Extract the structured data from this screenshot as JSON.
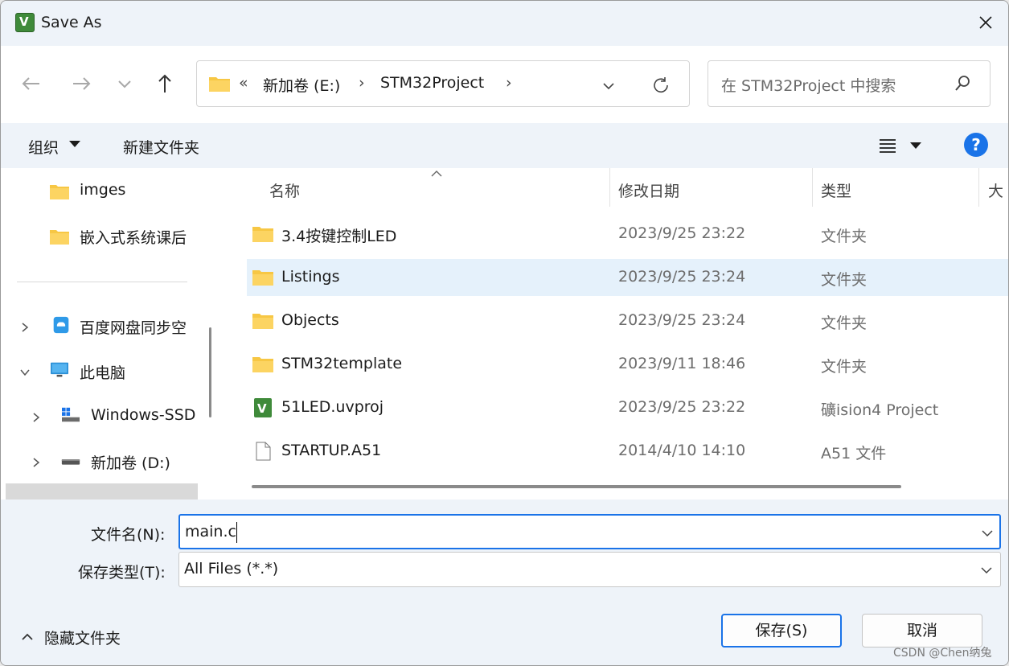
{
  "window": {
    "title": "Save As"
  },
  "nav": {
    "address": {
      "prefix": "«",
      "segments": [
        "新加卷 (E:)",
        "STM32Project"
      ]
    },
    "search_placeholder": "在 STM32Project 中搜索"
  },
  "toolbar": {
    "organize": "组织",
    "new_folder": "新建文件夹",
    "help": "?"
  },
  "sidebar": {
    "items": [
      {
        "label": "imges",
        "icon": "folder-icon"
      },
      {
        "label": "嵌入式系统课后",
        "icon": "folder-icon"
      },
      {
        "label": "百度网盘同步空",
        "icon": "cloud-sync-icon",
        "chevron": "right"
      },
      {
        "label": "此电脑",
        "icon": "computer-icon",
        "chevron": "down"
      },
      {
        "label": "Windows-SSD",
        "icon": "windows-drive-icon",
        "chevron": "right"
      },
      {
        "label": "新加卷 (D:)",
        "icon": "drive-icon",
        "chevron": "right"
      }
    ]
  },
  "columns": {
    "name": "名称",
    "date": "修改日期",
    "type": "类型",
    "size": "大"
  },
  "files": [
    {
      "name": "3.4按键控制LED",
      "date": "2023/9/25 23:22",
      "type": "文件夹",
      "icon": "folder-icon"
    },
    {
      "name": "Listings",
      "date": "2023/9/25 23:24",
      "type": "文件夹",
      "icon": "folder-icon",
      "selected": true
    },
    {
      "name": "Objects",
      "date": "2023/9/25 23:24",
      "type": "文件夹",
      "icon": "folder-icon"
    },
    {
      "name": "STM32template",
      "date": "2023/9/11 18:46",
      "type": "文件夹",
      "icon": "folder-icon"
    },
    {
      "name": "51LED.uvproj",
      "date": "2023/9/25 23:22",
      "type": "礦ision4 Project",
      "icon": "uvision-icon"
    },
    {
      "name": "STARTUP.A51",
      "date": "2014/4/10 14:10",
      "type": "A51 文件",
      "icon": "file-icon"
    }
  ],
  "form": {
    "filename_label": "文件名(N):",
    "filename_value": "main.c",
    "filetype_label": "保存类型(T):",
    "filetype_value": "All Files (*.*)"
  },
  "footer": {
    "hide_folders": "隐藏文件夹",
    "save": "保存(S)",
    "cancel": "取消",
    "watermark": "CSDN @Chen纳兔"
  },
  "colors": {
    "accent": "#1a73e8",
    "selected_row": "#e5f1fb",
    "folder": "#f7c744"
  }
}
